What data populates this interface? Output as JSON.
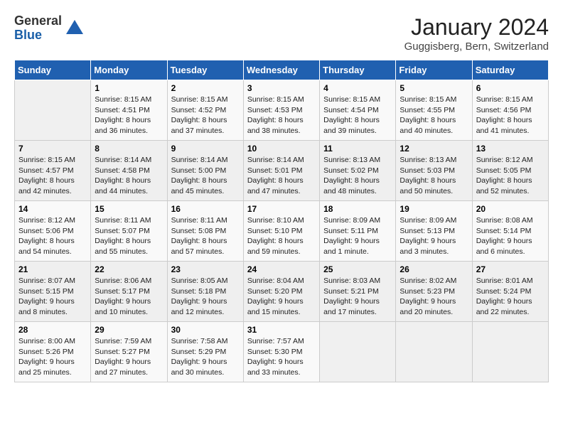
{
  "header": {
    "logo_general": "General",
    "logo_blue": "Blue",
    "month_year": "January 2024",
    "location": "Guggisberg, Bern, Switzerland"
  },
  "days_of_week": [
    "Sunday",
    "Monday",
    "Tuesday",
    "Wednesday",
    "Thursday",
    "Friday",
    "Saturday"
  ],
  "weeks": [
    [
      {
        "day": "",
        "empty": true
      },
      {
        "day": "1",
        "sunrise": "Sunrise: 8:15 AM",
        "sunset": "Sunset: 4:51 PM",
        "daylight": "Daylight: 8 hours and 36 minutes."
      },
      {
        "day": "2",
        "sunrise": "Sunrise: 8:15 AM",
        "sunset": "Sunset: 4:52 PM",
        "daylight": "Daylight: 8 hours and 37 minutes."
      },
      {
        "day": "3",
        "sunrise": "Sunrise: 8:15 AM",
        "sunset": "Sunset: 4:53 PM",
        "daylight": "Daylight: 8 hours and 38 minutes."
      },
      {
        "day": "4",
        "sunrise": "Sunrise: 8:15 AM",
        "sunset": "Sunset: 4:54 PM",
        "daylight": "Daylight: 8 hours and 39 minutes."
      },
      {
        "day": "5",
        "sunrise": "Sunrise: 8:15 AM",
        "sunset": "Sunset: 4:55 PM",
        "daylight": "Daylight: 8 hours and 40 minutes."
      },
      {
        "day": "6",
        "sunrise": "Sunrise: 8:15 AM",
        "sunset": "Sunset: 4:56 PM",
        "daylight": "Daylight: 8 hours and 41 minutes."
      }
    ],
    [
      {
        "day": "7",
        "sunrise": "Sunrise: 8:15 AM",
        "sunset": "Sunset: 4:57 PM",
        "daylight": "Daylight: 8 hours and 42 minutes."
      },
      {
        "day": "8",
        "sunrise": "Sunrise: 8:14 AM",
        "sunset": "Sunset: 4:58 PM",
        "daylight": "Daylight: 8 hours and 44 minutes."
      },
      {
        "day": "9",
        "sunrise": "Sunrise: 8:14 AM",
        "sunset": "Sunset: 5:00 PM",
        "daylight": "Daylight: 8 hours and 45 minutes."
      },
      {
        "day": "10",
        "sunrise": "Sunrise: 8:14 AM",
        "sunset": "Sunset: 5:01 PM",
        "daylight": "Daylight: 8 hours and 47 minutes."
      },
      {
        "day": "11",
        "sunrise": "Sunrise: 8:13 AM",
        "sunset": "Sunset: 5:02 PM",
        "daylight": "Daylight: 8 hours and 48 minutes."
      },
      {
        "day": "12",
        "sunrise": "Sunrise: 8:13 AM",
        "sunset": "Sunset: 5:03 PM",
        "daylight": "Daylight: 8 hours and 50 minutes."
      },
      {
        "day": "13",
        "sunrise": "Sunrise: 8:12 AM",
        "sunset": "Sunset: 5:05 PM",
        "daylight": "Daylight: 8 hours and 52 minutes."
      }
    ],
    [
      {
        "day": "14",
        "sunrise": "Sunrise: 8:12 AM",
        "sunset": "Sunset: 5:06 PM",
        "daylight": "Daylight: 8 hours and 54 minutes."
      },
      {
        "day": "15",
        "sunrise": "Sunrise: 8:11 AM",
        "sunset": "Sunset: 5:07 PM",
        "daylight": "Daylight: 8 hours and 55 minutes."
      },
      {
        "day": "16",
        "sunrise": "Sunrise: 8:11 AM",
        "sunset": "Sunset: 5:08 PM",
        "daylight": "Daylight: 8 hours and 57 minutes."
      },
      {
        "day": "17",
        "sunrise": "Sunrise: 8:10 AM",
        "sunset": "Sunset: 5:10 PM",
        "daylight": "Daylight: 8 hours and 59 minutes."
      },
      {
        "day": "18",
        "sunrise": "Sunrise: 8:09 AM",
        "sunset": "Sunset: 5:11 PM",
        "daylight": "Daylight: 9 hours and 1 minute."
      },
      {
        "day": "19",
        "sunrise": "Sunrise: 8:09 AM",
        "sunset": "Sunset: 5:13 PM",
        "daylight": "Daylight: 9 hours and 3 minutes."
      },
      {
        "day": "20",
        "sunrise": "Sunrise: 8:08 AM",
        "sunset": "Sunset: 5:14 PM",
        "daylight": "Daylight: 9 hours and 6 minutes."
      }
    ],
    [
      {
        "day": "21",
        "sunrise": "Sunrise: 8:07 AM",
        "sunset": "Sunset: 5:15 PM",
        "daylight": "Daylight: 9 hours and 8 minutes."
      },
      {
        "day": "22",
        "sunrise": "Sunrise: 8:06 AM",
        "sunset": "Sunset: 5:17 PM",
        "daylight": "Daylight: 9 hours and 10 minutes."
      },
      {
        "day": "23",
        "sunrise": "Sunrise: 8:05 AM",
        "sunset": "Sunset: 5:18 PM",
        "daylight": "Daylight: 9 hours and 12 minutes."
      },
      {
        "day": "24",
        "sunrise": "Sunrise: 8:04 AM",
        "sunset": "Sunset: 5:20 PM",
        "daylight": "Daylight: 9 hours and 15 minutes."
      },
      {
        "day": "25",
        "sunrise": "Sunrise: 8:03 AM",
        "sunset": "Sunset: 5:21 PM",
        "daylight": "Daylight: 9 hours and 17 minutes."
      },
      {
        "day": "26",
        "sunrise": "Sunrise: 8:02 AM",
        "sunset": "Sunset: 5:23 PM",
        "daylight": "Daylight: 9 hours and 20 minutes."
      },
      {
        "day": "27",
        "sunrise": "Sunrise: 8:01 AM",
        "sunset": "Sunset: 5:24 PM",
        "daylight": "Daylight: 9 hours and 22 minutes."
      }
    ],
    [
      {
        "day": "28",
        "sunrise": "Sunrise: 8:00 AM",
        "sunset": "Sunset: 5:26 PM",
        "daylight": "Daylight: 9 hours and 25 minutes."
      },
      {
        "day": "29",
        "sunrise": "Sunrise: 7:59 AM",
        "sunset": "Sunset: 5:27 PM",
        "daylight": "Daylight: 9 hours and 27 minutes."
      },
      {
        "day": "30",
        "sunrise": "Sunrise: 7:58 AM",
        "sunset": "Sunset: 5:29 PM",
        "daylight": "Daylight: 9 hours and 30 minutes."
      },
      {
        "day": "31",
        "sunrise": "Sunrise: 7:57 AM",
        "sunset": "Sunset: 5:30 PM",
        "daylight": "Daylight: 9 hours and 33 minutes."
      },
      {
        "day": "",
        "empty": true
      },
      {
        "day": "",
        "empty": true
      },
      {
        "day": "",
        "empty": true
      }
    ]
  ]
}
